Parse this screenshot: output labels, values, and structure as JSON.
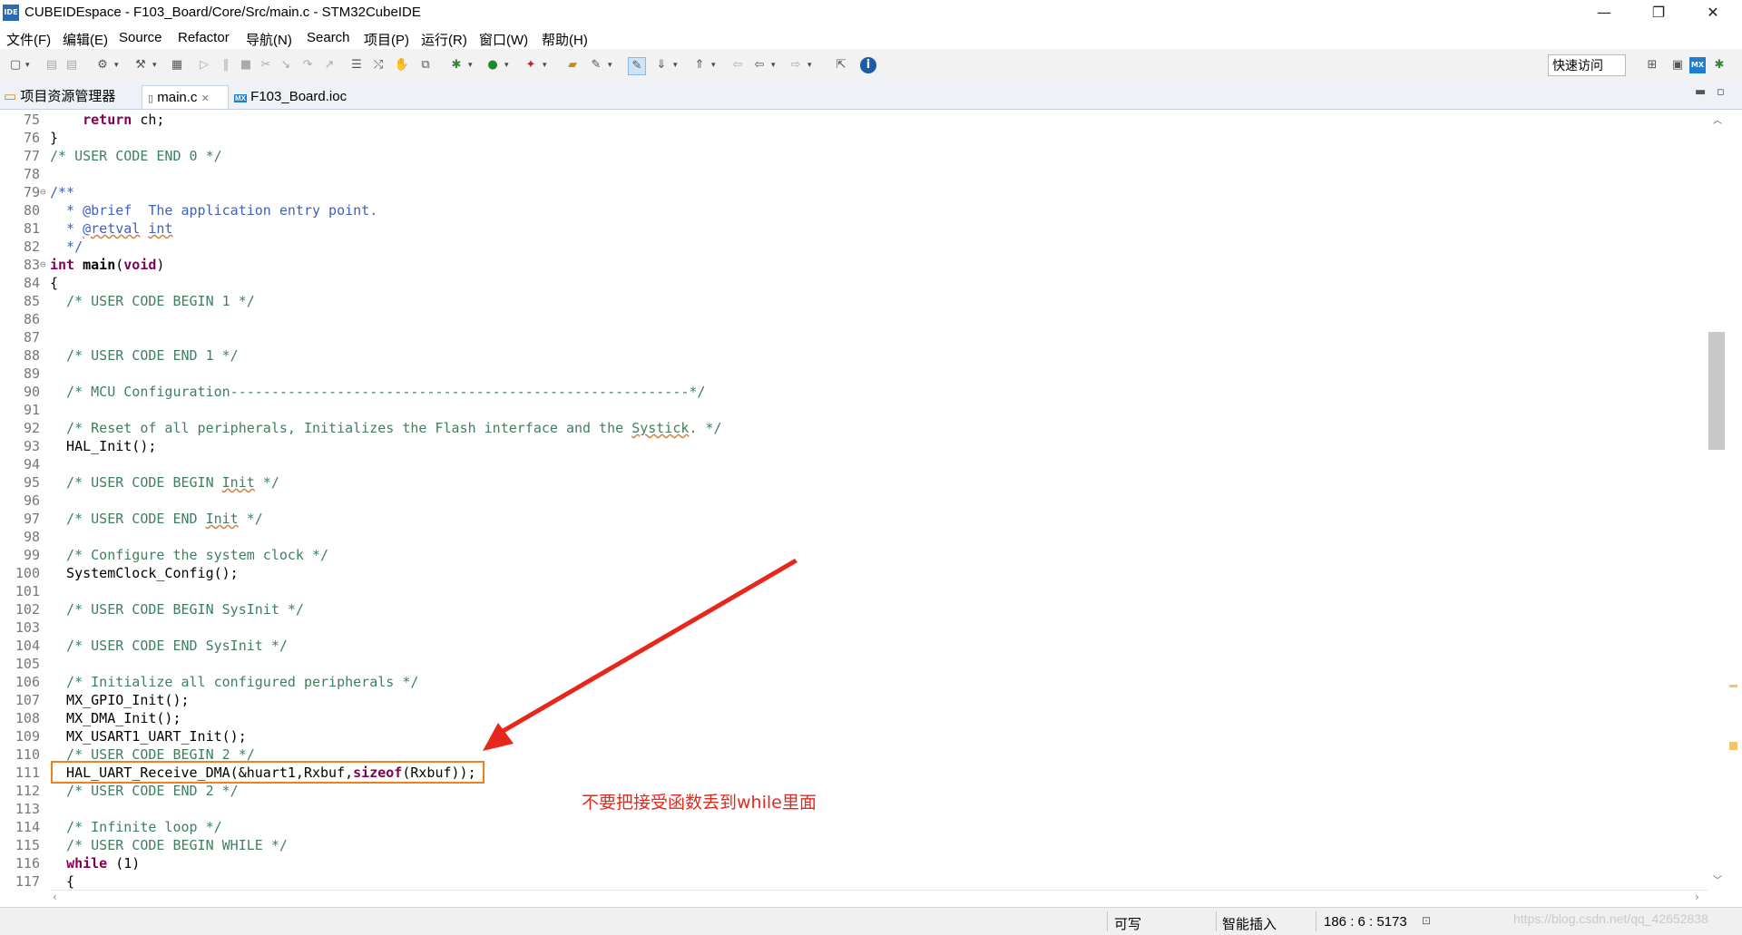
{
  "window": {
    "title": "CUBEIDEspace - F103_Board/Core/Src/main.c - STM32CubeIDE",
    "app_icon_text": "IDE",
    "controls": [
      "—",
      "❐",
      "✕"
    ]
  },
  "menu": [
    "文件(F)",
    "编辑(E)",
    "Source",
    "Refactor",
    "导航(N)",
    "Search",
    "项目(P)",
    "运行(R)",
    "窗口(W)",
    "帮助(H)"
  ],
  "toolbar": {
    "quick_access_placeholder": "快速访问"
  },
  "tabs": {
    "project_explorer": "项目资源管理器",
    "main_c": "main.c",
    "ioc": "F103_Board.ioc"
  },
  "code_lines": [
    {
      "n": "75",
      "fold": "",
      "segs": [
        [
          "",
          "    "
        ],
        [
          "kw",
          "return"
        ],
        [
          "",
          " ch;"
        ]
      ]
    },
    {
      "n": "76",
      "fold": "",
      "segs": [
        [
          "",
          "}"
        ]
      ]
    },
    {
      "n": "77",
      "fold": "",
      "segs": [
        [
          "cm",
          "/* USER CODE END 0 */"
        ]
      ]
    },
    {
      "n": "78",
      "fold": "",
      "segs": []
    },
    {
      "n": "79",
      "fold": "⊖",
      "segs": [
        [
          "dc",
          "/**"
        ]
      ]
    },
    {
      "n": "80",
      "fold": "",
      "segs": [
        [
          "dc",
          "  * @brief  The application entry point."
        ]
      ]
    },
    {
      "n": "81",
      "fold": "",
      "segs": [
        [
          "dc",
          "  * "
        ],
        [
          "dcsq",
          "@retval"
        ],
        [
          "dc",
          " "
        ],
        [
          "dcsq",
          "int"
        ]
      ]
    },
    {
      "n": "82",
      "fold": "",
      "segs": [
        [
          "dc",
          "  */"
        ]
      ]
    },
    {
      "n": "83",
      "fold": "⊖",
      "segs": [
        [
          "kw",
          "int"
        ],
        [
          "",
          " "
        ],
        [
          "b",
          "main"
        ],
        [
          "",
          "("
        ],
        [
          "kw",
          "void"
        ],
        [
          "",
          ")"
        ]
      ]
    },
    {
      "n": "84",
      "fold": "",
      "segs": [
        [
          "",
          "{"
        ]
      ]
    },
    {
      "n": "85",
      "fold": "",
      "segs": [
        [
          "cm",
          "  /* USER CODE BEGIN 1 */"
        ]
      ]
    },
    {
      "n": "86",
      "fold": "",
      "segs": []
    },
    {
      "n": "87",
      "fold": "",
      "segs": []
    },
    {
      "n": "88",
      "fold": "",
      "segs": [
        [
          "cm",
          "  /* USER CODE END 1 */"
        ]
      ]
    },
    {
      "n": "89",
      "fold": "",
      "segs": []
    },
    {
      "n": "90",
      "fold": "",
      "segs": [
        [
          "cm",
          "  /* MCU Configuration--------------------------------------------------------*/"
        ]
      ]
    },
    {
      "n": "91",
      "fold": "",
      "segs": []
    },
    {
      "n": "92",
      "fold": "",
      "segs": [
        [
          "cm",
          "  /* Reset of all peripherals, Initializes the Flash interface and the "
        ],
        [
          "cmsq",
          "Systick"
        ],
        [
          "cm",
          ". */"
        ]
      ]
    },
    {
      "n": "93",
      "fold": "",
      "segs": [
        [
          "",
          "  HAL_Init();"
        ]
      ]
    },
    {
      "n": "94",
      "fold": "",
      "segs": []
    },
    {
      "n": "95",
      "fold": "",
      "segs": [
        [
          "cm",
          "  /* USER CODE BEGIN "
        ],
        [
          "cmsq",
          "Init"
        ],
        [
          "cm",
          " */"
        ]
      ]
    },
    {
      "n": "96",
      "fold": "",
      "segs": []
    },
    {
      "n": "97",
      "fold": "",
      "segs": [
        [
          "cm",
          "  /* USER CODE END "
        ],
        [
          "cmsq",
          "Init"
        ],
        [
          "cm",
          " */"
        ]
      ]
    },
    {
      "n": "98",
      "fold": "",
      "segs": []
    },
    {
      "n": "99",
      "fold": "",
      "segs": [
        [
          "cm",
          "  /* Configure the system clock */"
        ]
      ]
    },
    {
      "n": "100",
      "fold": "",
      "segs": [
        [
          "",
          "  SystemClock_Config();"
        ]
      ]
    },
    {
      "n": "101",
      "fold": "",
      "segs": []
    },
    {
      "n": "102",
      "fold": "",
      "segs": [
        [
          "cm",
          "  /* USER CODE BEGIN SysInit */"
        ]
      ]
    },
    {
      "n": "103",
      "fold": "",
      "segs": []
    },
    {
      "n": "104",
      "fold": "",
      "segs": [
        [
          "cm",
          "  /* USER CODE END SysInit */"
        ]
      ]
    },
    {
      "n": "105",
      "fold": "",
      "segs": []
    },
    {
      "n": "106",
      "fold": "",
      "segs": [
        [
          "cm",
          "  /* Initialize all configured peripherals */"
        ]
      ]
    },
    {
      "n": "107",
      "fold": "",
      "segs": [
        [
          "",
          "  MX_GPIO_Init();"
        ]
      ]
    },
    {
      "n": "108",
      "fold": "",
      "segs": [
        [
          "",
          "  MX_DMA_Init();"
        ]
      ]
    },
    {
      "n": "109",
      "fold": "",
      "segs": [
        [
          "",
          "  MX_USART1_UART_Init();"
        ]
      ]
    },
    {
      "n": "110",
      "fold": "",
      "segs": [
        [
          "cm",
          "  /* USER CODE BEGIN 2 */"
        ]
      ]
    },
    {
      "n": "111",
      "fold": "",
      "segs": [
        [
          "",
          "  HAL_UART_Receive_DMA(&huart1,Rxbuf,"
        ],
        [
          "kw",
          "sizeof"
        ],
        [
          "",
          "(Rxbuf));"
        ]
      ]
    },
    {
      "n": "112",
      "fold": "",
      "segs": [
        [
          "cm",
          "  /* USER CODE END 2 */"
        ]
      ]
    },
    {
      "n": "113",
      "fold": "",
      "segs": []
    },
    {
      "n": "114",
      "fold": "",
      "segs": [
        [
          "cm",
          "  /* Infinite loop */"
        ]
      ]
    },
    {
      "n": "115",
      "fold": "",
      "segs": [
        [
          "cm",
          "  /* USER CODE BEGIN WHILE */"
        ]
      ]
    },
    {
      "n": "116",
      "fold": "",
      "segs": [
        [
          "",
          "  "
        ],
        [
          "kw",
          "while"
        ],
        [
          "",
          " (1)"
        ]
      ]
    },
    {
      "n": "117",
      "fold": "",
      "segs": [
        [
          "",
          "  {"
        ]
      ]
    }
  ],
  "annotation": {
    "text": "不要把接受函数丢到while里面",
    "color": "#e8271c",
    "box_color": "#f07f1e"
  },
  "status": {
    "writable": "可写",
    "insert_mode": "智能插入",
    "position": "186 : 6 : 5173"
  },
  "watermark": "https://blog.csdn.net/qq_42652838"
}
